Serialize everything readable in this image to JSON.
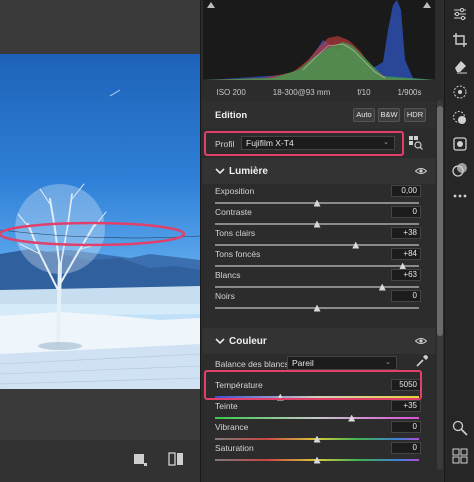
{
  "histogram": {
    "info": {
      "iso": "ISO 200",
      "focal": "18-300@93 mm",
      "aperture": "f/10",
      "shutter": "1/900s"
    }
  },
  "edition": {
    "title": "Edition",
    "buttons": {
      "auto": "Auto",
      "bw": "B&W",
      "hdr": "HDR"
    },
    "profile_label": "Profil",
    "profile_value": "Fujifilm X-T4"
  },
  "lumiere": {
    "title": "Lumière",
    "sliders": [
      {
        "label": "Exposition",
        "value": "0,00",
        "level": 0.5
      },
      {
        "label": "Contraste",
        "value": "0",
        "level": 0.5
      },
      {
        "label": "Tons clairs",
        "value": "+38",
        "level": 0.69
      },
      {
        "label": "Tons foncés",
        "value": "+84",
        "level": 0.92
      },
      {
        "label": "Blancs",
        "value": "+63",
        "level": 0.82
      },
      {
        "label": "Noirs",
        "value": "0",
        "level": 0.5
      }
    ]
  },
  "couleur": {
    "title": "Couleur",
    "wb_label": "Balance des blancs",
    "wb_value": "Pareil",
    "sliders": [
      {
        "label": "Température",
        "value": "5050",
        "level": 0.32,
        "kind": "temp"
      },
      {
        "label": "Teinte",
        "value": "+35",
        "level": 0.67,
        "kind": "tint"
      },
      {
        "label": "Vibrance",
        "value": "0",
        "level": 0.5,
        "kind": "vib"
      },
      {
        "label": "Saturation",
        "value": "0",
        "level": 0.5,
        "kind": "sat"
      }
    ]
  },
  "colors": {
    "highlight": "#e0406a",
    "panel": "#2c2c2c",
    "accent": "#d8d8d8"
  }
}
